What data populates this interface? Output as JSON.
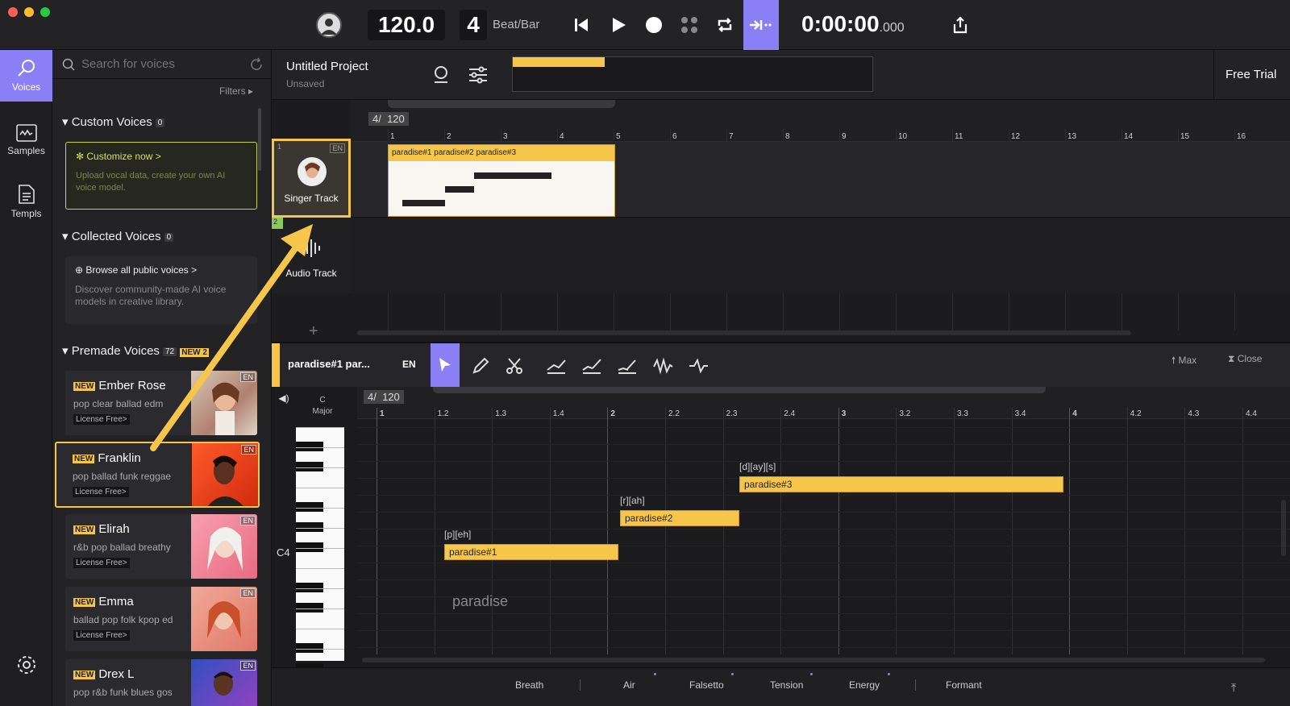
{
  "transport": {
    "tempo": "120.0",
    "beats": "4",
    "beat_label": "Beat/Bar",
    "time_main": "0:00:00",
    "time_ms": ".000"
  },
  "nav": {
    "voices": "Voices",
    "samples": "Samples",
    "templs": "Templs"
  },
  "voices_panel": {
    "search_placeholder": "Search for voices",
    "filters": "Filters ▸",
    "custom": {
      "title": "Custom Voices",
      "count": "0",
      "cta": "Customize now >",
      "desc": "Upload vocal data, create your own AI voice model."
    },
    "collected": {
      "title": "Collected Voices",
      "count": "0",
      "cta": "Browse all public voices >",
      "desc": "Discover community-made AI voice models in creative library."
    },
    "premade": {
      "title": "Premade Voices",
      "count": "72",
      "new_badge": "NEW 2"
    },
    "cards": [
      {
        "new": "NEW",
        "name": "Ember Rose",
        "tags": "pop clear ballad edm",
        "license": "License Free>",
        "lang": "EN"
      },
      {
        "new": "NEW",
        "name": "Franklin",
        "tags": "pop ballad funk reggae",
        "license": "License Free>",
        "lang": "EN"
      },
      {
        "new": "NEW",
        "name": "Elirah",
        "tags": "r&b pop ballad breathy",
        "license": "License Free>",
        "lang": "EN"
      },
      {
        "new": "NEW",
        "name": "Emma",
        "tags": "ballad pop folk kpop ed",
        "license": "License Free>",
        "lang": "EN"
      },
      {
        "new": "NEW",
        "name": "Drex L",
        "tags": "pop r&b funk blues gos",
        "license": "License Free>",
        "lang": "EN"
      }
    ]
  },
  "project": {
    "name": "Untitled Project",
    "status": "Unsaved",
    "free_trial": "Free Trial"
  },
  "arrange": {
    "timesig": "4/",
    "tempo": "120",
    "bars": [
      "1",
      "2",
      "3",
      "4",
      "5",
      "6",
      "7",
      "8",
      "9",
      "10",
      "11",
      "12",
      "13",
      "14",
      "15",
      "16"
    ],
    "tracks": [
      {
        "num": "1",
        "name": "Singer Track",
        "lang": "EN"
      },
      {
        "num": "2",
        "name": "Audio Track"
      }
    ],
    "clip_label": "paradise#1 paradise#2 paradise#3"
  },
  "editor": {
    "clip_name": "paradise#1 par...",
    "lang": "EN",
    "max": "Max",
    "close": "Close",
    "key": "C",
    "scale": "Major",
    "timesig": "4/",
    "tempo": "120",
    "c4": "C4",
    "ruler": [
      {
        "label": "1",
        "major": true
      },
      {
        "label": "1.2"
      },
      {
        "label": "1.3"
      },
      {
        "label": "1.4"
      },
      {
        "label": "2",
        "major": true
      },
      {
        "label": "2.2"
      },
      {
        "label": "2.3"
      },
      {
        "label": "2.4"
      },
      {
        "label": "3",
        "major": true
      },
      {
        "label": "3.2"
      },
      {
        "label": "3.3"
      },
      {
        "label": "3.4"
      },
      {
        "label": "4",
        "major": true
      },
      {
        "label": "4.2"
      },
      {
        "label": "4.3"
      },
      {
        "label": "4.4"
      }
    ],
    "notes": [
      {
        "label": "paradise#1",
        "phonemes": "[p][eh]"
      },
      {
        "label": "paradise#2",
        "phonemes": "[r][ah]"
      },
      {
        "label": "paradise#3",
        "phonemes": "[d][ay][s]"
      }
    ],
    "lyric": "paradise"
  },
  "params": [
    "Breath",
    "Air",
    "Falsetto",
    "Tension",
    "Energy",
    "Formant"
  ],
  "colors": {
    "accent": "#8b7ff5",
    "highlight": "#f5c64a"
  }
}
